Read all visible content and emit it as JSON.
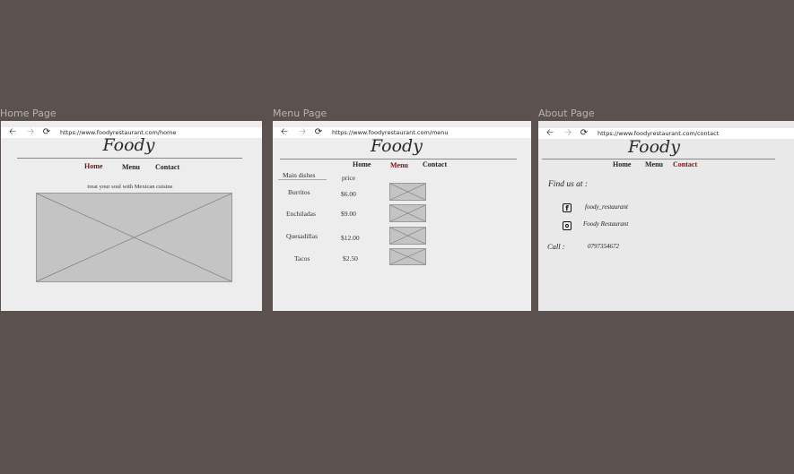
{
  "frames": {
    "home": {
      "label": "Home Page",
      "url": "https://www.foodyrestaurant.com/home",
      "logo": "Foody",
      "nav": [
        "Home",
        "Menu",
        "Contact"
      ],
      "tagline": "treat your soul with Mexican cuisine"
    },
    "menu": {
      "label": "Menu Page",
      "url": "https://www.foodyrestaurant.com/menu",
      "logo": "Foody",
      "nav": [
        "Home",
        "Menu",
        "Contact"
      ],
      "col_dishes": "Main dishes",
      "col_price": "price",
      "items": [
        {
          "name": "Burritos",
          "price": "$6.00"
        },
        {
          "name": "Enchiladas",
          "price": "$9.00"
        },
        {
          "name": "Quesadillas",
          "price": "$12.00"
        },
        {
          "name": "Tacos",
          "price": "$2.50"
        }
      ]
    },
    "about": {
      "label": "About Page",
      "url": "https://www.foodyrestaurant.com/contact",
      "logo": "Foody",
      "nav": [
        "Home",
        "Menu",
        "Contact"
      ],
      "find_us": "Find us at :",
      "facebook": "foody_restaurant",
      "instagram": "Foody Restaurant",
      "call_label": "Call :",
      "phone": "0797354672"
    }
  },
  "icons": {
    "back": "arrow-left",
    "forward": "arrow-right",
    "reload": "reload",
    "facebook": "facebook",
    "instagram": "instagram"
  },
  "colors": {
    "canvas": "#5b514e",
    "frame": "#ededed",
    "active_nav": "#7b1111"
  }
}
